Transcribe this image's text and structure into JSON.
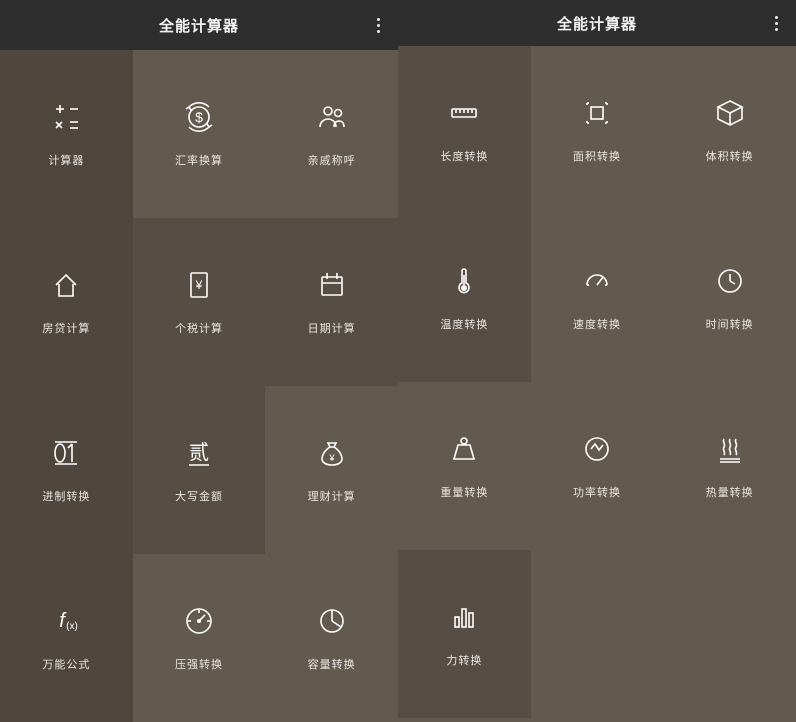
{
  "left": {
    "title": "全能计算器",
    "tiles": [
      [
        {
          "id": "calculator",
          "label": "计算器",
          "icon": "calc",
          "shade": "dark"
        },
        {
          "id": "currency",
          "label": "汇率换算",
          "icon": "currency",
          "shade": "light"
        },
        {
          "id": "relative",
          "label": "亲戚称呼",
          "icon": "people",
          "shade": "light"
        }
      ],
      [
        {
          "id": "mortgage",
          "label": "房贷计算",
          "icon": "home",
          "shade": "dark"
        },
        {
          "id": "tax",
          "label": "个税计算",
          "icon": "doc-yen",
          "shade": "mid"
        },
        {
          "id": "date",
          "label": "日期计算",
          "icon": "calendar",
          "shade": "mid"
        }
      ],
      [
        {
          "id": "radix",
          "label": "进制转换",
          "icon": "binary",
          "shade": "dark"
        },
        {
          "id": "upper",
          "label": "大写金额",
          "icon": "cn-num",
          "shade": "mid"
        },
        {
          "id": "finance",
          "label": "理财计算",
          "icon": "moneybag",
          "shade": "light"
        }
      ],
      [
        {
          "id": "formula",
          "label": "万能公式",
          "icon": "fx",
          "shade": "dark"
        },
        {
          "id": "pressure",
          "label": "压强转换",
          "icon": "gauge",
          "shade": "light"
        },
        {
          "id": "volume-cap",
          "label": "容量转换",
          "icon": "pie",
          "shade": "light"
        }
      ]
    ]
  },
  "right": {
    "title": "全能计算器",
    "tiles": [
      [
        {
          "id": "length",
          "label": "长度转换",
          "icon": "ruler",
          "shade": "mid"
        },
        {
          "id": "area",
          "label": "面积转换",
          "icon": "area",
          "shade": "light"
        },
        {
          "id": "volume",
          "label": "体积转换",
          "icon": "cube",
          "shade": "light"
        }
      ],
      [
        {
          "id": "temperature",
          "label": "温度转换",
          "icon": "thermo",
          "shade": "mid"
        },
        {
          "id": "speed",
          "label": "速度转换",
          "icon": "speed",
          "shade": "light"
        },
        {
          "id": "time",
          "label": "时间转换",
          "icon": "clock",
          "shade": "light"
        }
      ],
      [
        {
          "id": "weight",
          "label": "重量转换",
          "icon": "weight",
          "shade": "light"
        },
        {
          "id": "power",
          "label": "功率转换",
          "icon": "power",
          "shade": "light"
        },
        {
          "id": "heat",
          "label": "热量转换",
          "icon": "heat",
          "shade": "light"
        }
      ],
      [
        {
          "id": "force",
          "label": "力转换",
          "icon": "bars",
          "shade": "mid"
        },
        {
          "id": "",
          "label": "",
          "icon": "",
          "shade": "light",
          "empty": true
        },
        {
          "id": "",
          "label": "",
          "icon": "",
          "shade": "light",
          "empty": true
        }
      ]
    ]
  }
}
